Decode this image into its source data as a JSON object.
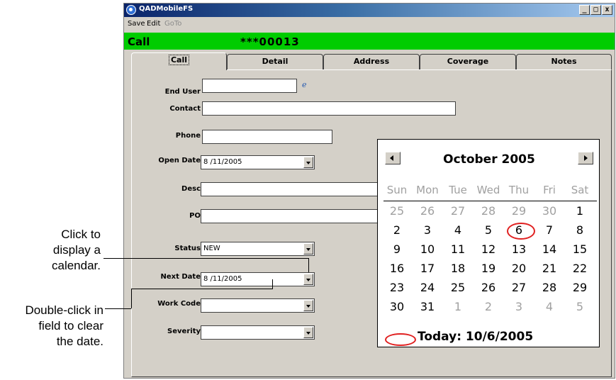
{
  "window": {
    "title": "QADMobileFS",
    "controls": {
      "minimize": "_",
      "maximize": "□",
      "close": "x"
    }
  },
  "menu": {
    "items": [
      "Save",
      "Edit",
      "GoTo"
    ]
  },
  "header": {
    "label": "Call",
    "number": "***00013",
    "color": "#00cc00"
  },
  "tabs": [
    "Call",
    "Detail",
    "Address",
    "Coverage",
    "Notes"
  ],
  "form": {
    "end_user": {
      "label": "End User",
      "value": ""
    },
    "contact": {
      "label": "Contact",
      "value": ""
    },
    "phone": {
      "label": "Phone",
      "value": ""
    },
    "open_date": {
      "label": "Open Date",
      "value": "8 /11/2005"
    },
    "desc": {
      "label": "Desc",
      "value": ""
    },
    "po": {
      "label": "PO",
      "value": ""
    },
    "status": {
      "label": "Status",
      "value": "NEW"
    },
    "next_date": {
      "label": "Next Date",
      "value": "8 /11/2005"
    },
    "work_code": {
      "label": "Work Code",
      "value": ""
    },
    "severity": {
      "label": "Severity",
      "value": ""
    }
  },
  "calendar": {
    "month": "October 2005",
    "weekdays": [
      "Sun",
      "Mon",
      "Tue",
      "Wed",
      "Thu",
      "Fri",
      "Sat"
    ],
    "weeks": [
      [
        "25",
        "26",
        "27",
        "28",
        "29",
        "30",
        "1"
      ],
      [
        "2",
        "3",
        "4",
        "5",
        "6",
        "7",
        "8"
      ],
      [
        "9",
        "10",
        "11",
        "12",
        "13",
        "14",
        "15"
      ],
      [
        "16",
        "17",
        "18",
        "19",
        "20",
        "21",
        "22"
      ],
      [
        "23",
        "24",
        "25",
        "26",
        "27",
        "28",
        "29"
      ],
      [
        "30",
        "31",
        "1",
        "2",
        "3",
        "4",
        "5"
      ]
    ],
    "today": "Today: 10/6/2005",
    "highlight_color": "#e02020"
  },
  "callouts": {
    "calendar": [
      "Click to",
      "display a",
      "calendar."
    ],
    "clear": [
      "Double-click in",
      "field to clear",
      "the date."
    ]
  }
}
